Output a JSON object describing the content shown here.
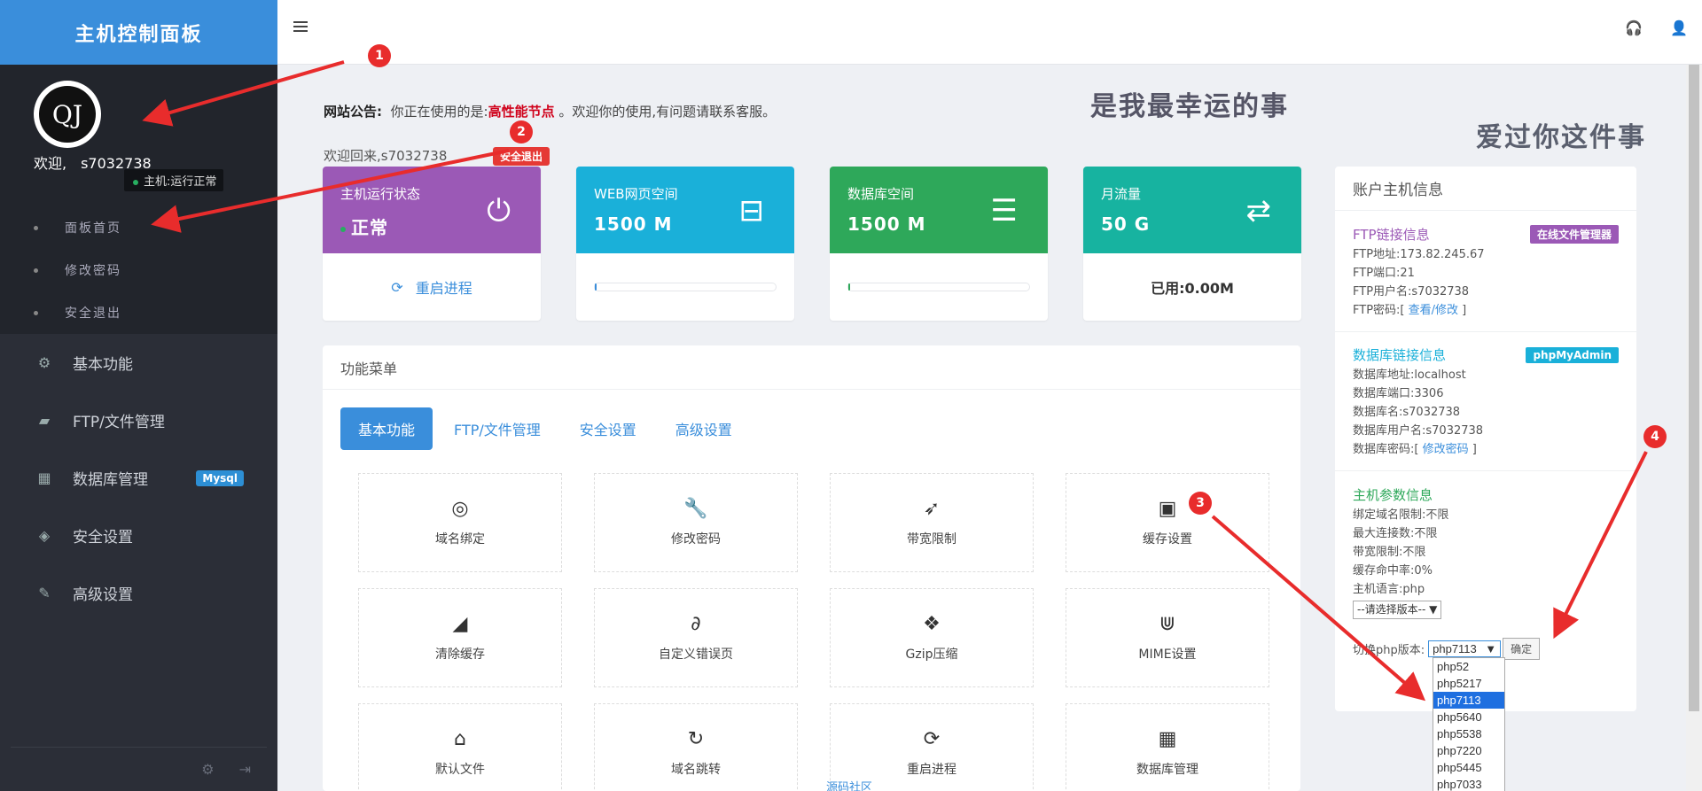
{
  "sidebar": {
    "brand": "主机控制面板",
    "avatar_text": "QJ",
    "welcome": "欢迎,",
    "username": "s7032738",
    "host_status": "主机:运行正常",
    "subnav": [
      {
        "label": "面板首页"
      },
      {
        "label": "修改密码"
      },
      {
        "label": "安全退出"
      }
    ],
    "mainnav": [
      {
        "icon": "gears-icon",
        "label": "基本功能"
      },
      {
        "icon": "folder-open-icon",
        "label": "FTP/文件管理"
      },
      {
        "icon": "table-icon",
        "label": "数据库管理",
        "badge": "Mysql"
      },
      {
        "icon": "shield-icon",
        "label": "安全设置"
      },
      {
        "icon": "edit-icon",
        "label": "高级设置"
      }
    ]
  },
  "notice": {
    "label": "网站公告:",
    "prefix": "你正在使用的是:",
    "highlight": "高性能节点",
    "suffix": "。欢迎你的使用,有问题请联系客服。"
  },
  "decor": {
    "text1": "是我最幸运的事",
    "text2": "爱过你这件事"
  },
  "welcome_back": "欢迎回来,s7032738",
  "logout_tag": "安全退出",
  "cards": [
    {
      "title": "主机运行状态",
      "value": "正常",
      "color": "#9b59b6",
      "footer": "重启进程",
      "icon": "power-icon"
    },
    {
      "title": "WEB网页空间",
      "value": "1500 M",
      "color": "#1ab0d9",
      "icon": "hdd-icon",
      "progress": 0.01
    },
    {
      "title": "数据库空间",
      "value": "1500 M",
      "color": "#2ea85a",
      "icon": "database-icon",
      "progress": 0.01
    },
    {
      "title": "月流量",
      "value": "50 G",
      "color": "#17b3a0",
      "footer": "已用:0.00M",
      "icon": "exchange-icon"
    }
  ],
  "panel": {
    "title": "功能菜单",
    "tabs": [
      "基本功能",
      "FTP/文件管理",
      "安全设置",
      "高级设置"
    ],
    "tiles": [
      {
        "icon": "dribbble-icon",
        "glyph": "◎",
        "label": "域名绑定"
      },
      {
        "icon": "wrench-icon",
        "glyph": "🔧",
        "label": "修改密码"
      },
      {
        "icon": "rocket-icon",
        "glyph": "➶",
        "label": "带宽限制"
      },
      {
        "icon": "save-icon",
        "glyph": "▣",
        "label": "缓存设置"
      },
      {
        "icon": "eraser-icon",
        "glyph": "◢",
        "label": "清除缓存"
      },
      {
        "icon": "paperclip-icon",
        "glyph": "∂",
        "label": "自定义错误页"
      },
      {
        "icon": "dropbox-icon",
        "glyph": "❖",
        "label": "Gzip压缩"
      },
      {
        "icon": "magnet-icon",
        "glyph": "⋓",
        "label": "MIME设置"
      },
      {
        "icon": "home-icon",
        "glyph": "⌂",
        "label": "默认文件"
      },
      {
        "icon": "redo-icon",
        "glyph": "↻",
        "label": "域名跳转"
      },
      {
        "icon": "refresh-icon",
        "glyph": "⟳",
        "label": "重启进程"
      },
      {
        "icon": "table-icon",
        "glyph": "▦",
        "label": "数据库管理"
      }
    ]
  },
  "footer_link": "源码社区",
  "account": {
    "title": "账户主机信息",
    "ftp": {
      "title": "FTP链接信息",
      "button": "在线文件管理器",
      "address": "FTP地址:173.82.245.67",
      "port": "FTP端口:21",
      "user": "FTP用户名:s7032738",
      "pwd_prefix": "FTP密码:[ ",
      "pwd_link": "查看/修改",
      "pwd_suffix": " ]"
    },
    "db": {
      "title": "数据库链接信息",
      "button": "phpMyAdmin",
      "address": "数据库地址:localhost",
      "port": "数据库端口:3306",
      "name": "数据库名:s7032738",
      "user": "数据库用户名:s7032738",
      "pwd_prefix": "数据库密码:[ ",
      "pwd_link": "修改密码",
      "pwd_suffix": " ]"
    },
    "host": {
      "title": "主机参数信息",
      "domains": "绑定域名限制:不限",
      "conns": "最大连接数:不限",
      "bandwidth": "带宽限制:不限",
      "cache": "缓存命中率:0%",
      "lang": "主机语言:php",
      "version_select": "--请选择版本--",
      "php_label": "切换php版本:",
      "php_value": "php7113",
      "ok": "确定"
    },
    "php_options": [
      "php52",
      "php5217",
      "php7113",
      "php5640",
      "php5538",
      "php7220",
      "php5445",
      "php7033"
    ],
    "php_selected": "php7113"
  },
  "annotations": [
    "1",
    "2",
    "3",
    "4"
  ]
}
